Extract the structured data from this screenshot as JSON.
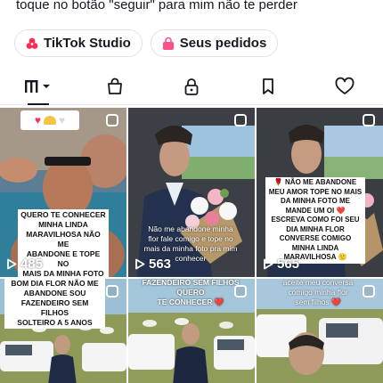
{
  "profile": {
    "bio_line": "toque no botão \"seguir\" para mim não te perder"
  },
  "chips": [
    {
      "label": "TikTok Studio",
      "icon": "tiktok-studio-icon"
    },
    {
      "label": "Seus pedidos",
      "icon": "orders-bag-icon"
    }
  ],
  "tabs": [
    {
      "name": "videos-grid",
      "icon": "grid-icon",
      "active": true
    },
    {
      "name": "shop",
      "icon": "shopping-bag-icon",
      "active": false
    },
    {
      "name": "private",
      "icon": "lock-icon",
      "active": false
    },
    {
      "name": "saved",
      "icon": "bookmark-icon",
      "active": false
    },
    {
      "name": "liked",
      "icon": "heart-icon",
      "active": false
    }
  ],
  "videos": [
    {
      "views": "485",
      "caption": "QUERO TE CONHECER\nMINHA LINDA\nMARAVILHOSA NÃO ME\nABANDONE E TOPE NO\nMAIS DA MINHA FOTO ❤️"
    },
    {
      "views": "563",
      "caption": "Não me abandone minha\nflor fale comigo e tope no\nmais da minha foto pra mim\nconhecer"
    },
    {
      "views": "565",
      "caption": "🌹 NÃO ME ABANDONE\nMEU AMOR TOPE NO MAIS\nDA MINHA FOTO ME\nMANDE UM OI ❤️\nESCREVA COMO FOI SEU\nDIA MINHA FLOR\nCONVERSE COMIGO\nMINHA LINDA\nMARAVILHOSA 🙂"
    },
    {
      "views": "",
      "caption": "BOM DIA FLOR NÃO ME\nABANDONE SOU\nFAZENDEIRO SEM FILHOS\nSOLTEIRO A 5 ANOS"
    },
    {
      "views": "",
      "caption": "FAZENDEIRO SEM FILHOS QUERO\nTE CONHECER ❤️"
    },
    {
      "views": "",
      "caption": "aceite meu conversa\ncomigo minha flor\nsem filhos ❤️"
    }
  ],
  "colors": {
    "text": "#161823",
    "border": "#e3e3e6",
    "studio_icon": "#fe2c55",
    "orders_icon": "#ff4f8b"
  }
}
